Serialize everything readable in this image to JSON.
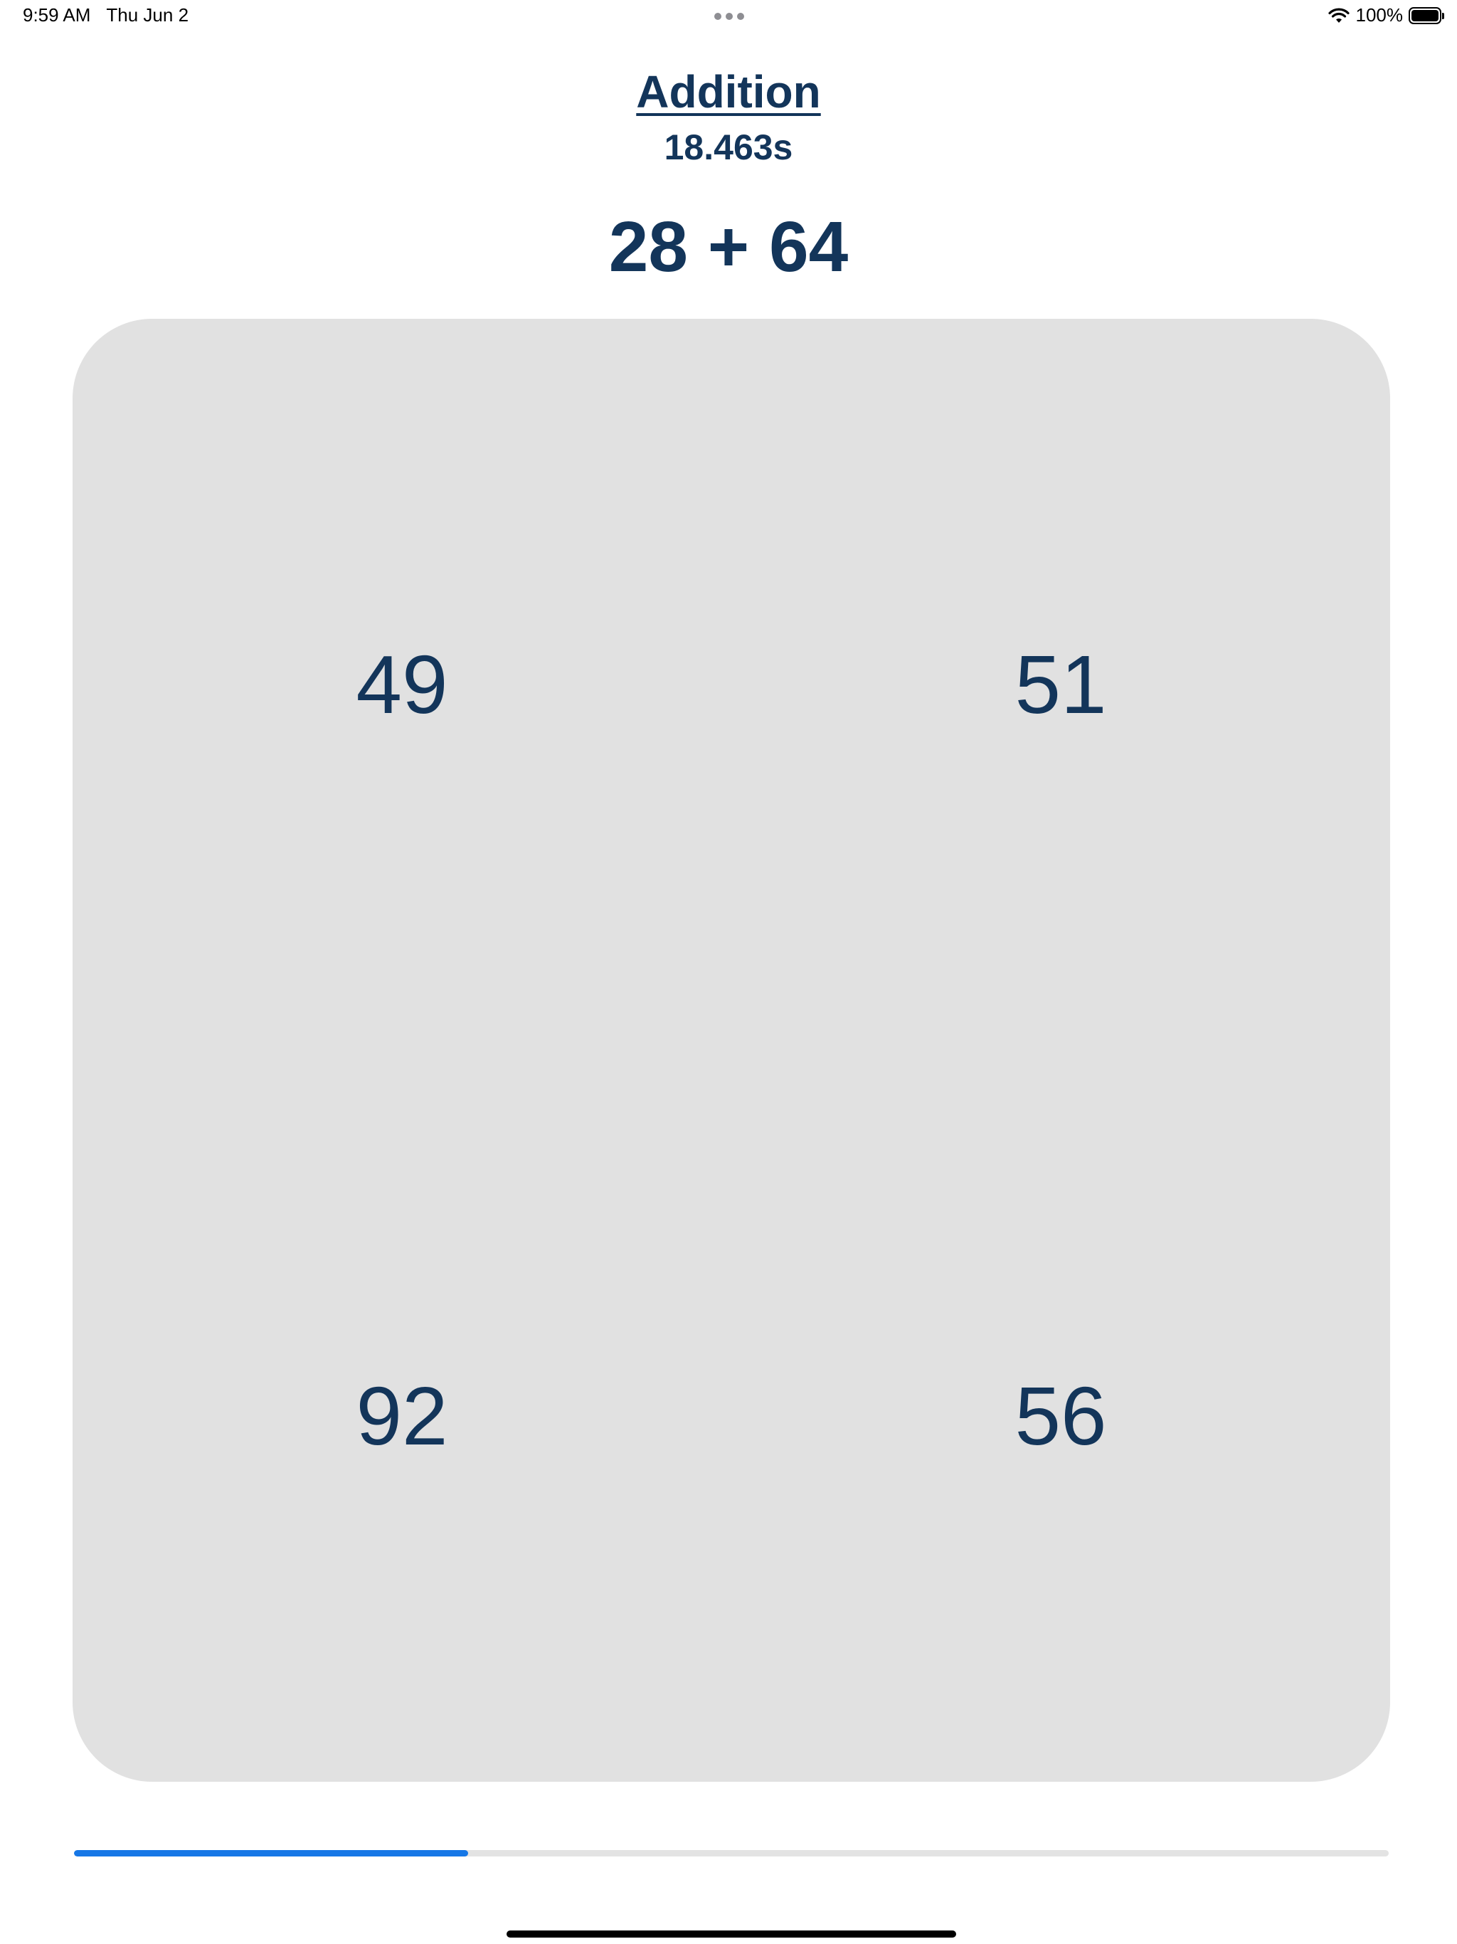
{
  "status_bar": {
    "time": "9:59 AM",
    "date": "Thu Jun 2",
    "battery_text": "100%",
    "battery_level": 1.0
  },
  "quiz": {
    "title": "Addition",
    "timer": "18.463s",
    "problem": "28 + 64",
    "answers": [
      "49",
      "51",
      "92",
      "56"
    ],
    "progress": 0.3
  },
  "colors": {
    "text": "#13355a",
    "board": "#e1e1e1",
    "progress_fill": "#1677e6",
    "progress_track": "#e3e3e3"
  }
}
